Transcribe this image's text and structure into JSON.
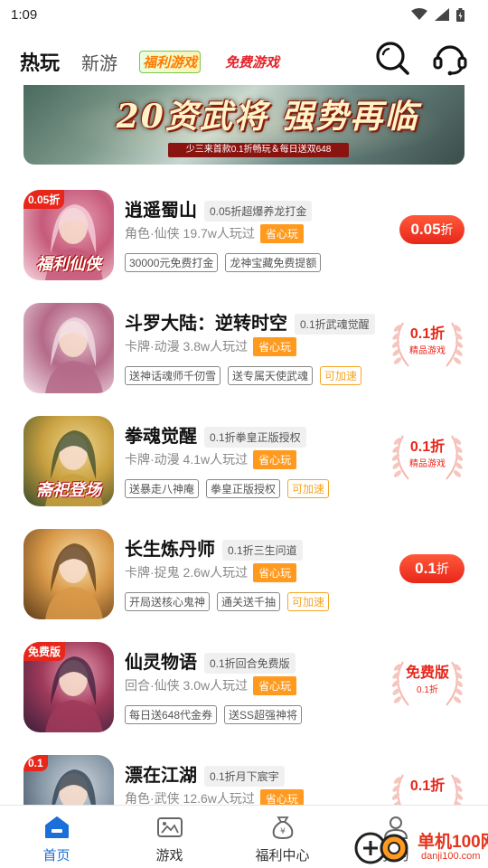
{
  "status_bar": {
    "time": "1:09",
    "icons": [
      "wifi-icon",
      "signal-icon",
      "battery-icon"
    ]
  },
  "top_nav": {
    "tabs": [
      {
        "label": "热玩",
        "active": true
      },
      {
        "label": "新游",
        "active": false
      },
      {
        "label": "福利游戏",
        "active": false
      },
      {
        "label": "免费游戏",
        "active": false
      }
    ],
    "icons": [
      "search-icon",
      "customer-service-icon"
    ]
  },
  "banner": {
    "title": "20资武将 强势再临",
    "subtitle": "少三来首款0.1折畅玩＆每日送双648"
  },
  "games": [
    {
      "name": "逍遥蜀山",
      "promo": "0.05折超爆养龙打金",
      "meta": "角色·仙侠 19.7w人玩过",
      "save": "省心玩",
      "tags": [
        {
          "text": "30000元免费打金",
          "accel": false
        },
        {
          "text": "龙神宝藏免费提额",
          "accel": false
        }
      ],
      "discount": {
        "style": "pill",
        "num": "0.05",
        "unit": "折"
      },
      "icon": {
        "name": "xiaoyao-shushan-icon",
        "label": "0.05折",
        "overlay": "福利仙侠",
        "colors": [
          "#f7d6e0",
          "#c65a7a",
          "#e8a0b4"
        ]
      }
    },
    {
      "name": "斗罗大陆：逆转时空",
      "promo": "0.1折武魂觉醒",
      "meta": "卡牌·动漫 3.8w人玩过",
      "save": "省心玩",
      "tags": [
        {
          "text": "送神话魂师千仞雪",
          "accel": false
        },
        {
          "text": "送专属天使武魂",
          "accel": false
        },
        {
          "text": "可加速",
          "accel": true
        }
      ],
      "discount": {
        "style": "seal",
        "main": "0.1折",
        "sub": "精品游戏"
      },
      "icon": {
        "name": "douluo-dalu-icon",
        "label": "",
        "overlay": "",
        "colors": [
          "#f3e0e8",
          "#b46a88",
          "#e8c4d0"
        ]
      }
    },
    {
      "name": "拳魂觉醒",
      "promo": "0.1折拳皇正版授权",
      "meta": "卡牌·动漫 4.1w人玩过",
      "save": "省心玩",
      "tags": [
        {
          "text": "送暴走八神庵",
          "accel": false
        },
        {
          "text": "拳皇正版授权",
          "accel": false
        },
        {
          "text": "可加速",
          "accel": true
        }
      ],
      "discount": {
        "style": "seal",
        "main": "0.1折",
        "sub": "精品游戏"
      },
      "icon": {
        "name": "quanhun-juexing-icon",
        "label": "",
        "overlay": "斋祀登场",
        "colors": [
          "#3a4a2a",
          "#c8a040",
          "#f0d890"
        ]
      }
    },
    {
      "name": "长生炼丹师",
      "promo": "0.1折三生问道",
      "meta": "卡牌·捉鬼 2.6w人玩过",
      "save": "省心玩",
      "tags": [
        {
          "text": "开局送核心鬼神",
          "accel": false
        },
        {
          "text": "通关送千抽",
          "accel": false
        },
        {
          "text": "可加速",
          "accel": true
        }
      ],
      "discount": {
        "style": "pill",
        "num": "0.1",
        "unit": "折"
      },
      "icon": {
        "name": "changsheng-liandanshi-icon",
        "label": "",
        "overlay": "",
        "colors": [
          "#5a3a18",
          "#d89848",
          "#f8e0a8"
        ]
      }
    },
    {
      "name": "仙灵物语",
      "promo": "0.1折回合免费版",
      "meta": "回合·仙侠 3.0w人玩过",
      "save": "省心玩",
      "tags": [
        {
          "text": "每日送648代金券",
          "accel": false
        },
        {
          "text": "送SS超强神将",
          "accel": false
        }
      ],
      "discount": {
        "style": "seal",
        "main": "免费版",
        "sub": "0.1折"
      },
      "icon": {
        "name": "xianling-wuyu-icon",
        "label": "免费版",
        "overlay": "",
        "colors": [
          "#3a1e3a",
          "#a03a5a",
          "#e8a0b8"
        ]
      }
    },
    {
      "name": "漂在江湖",
      "promo": "0.1折月下宸宇",
      "meta": "角色·武侠 12.6w人玩过",
      "save": "省心玩",
      "tags": [],
      "discount": {
        "style": "seal",
        "main": "0.1折",
        "sub": ""
      },
      "icon": {
        "name": "piaozai-jianghu-icon",
        "label": "0.1",
        "overlay": "",
        "colors": [
          "#2a3a4a",
          "#8a9aa8",
          "#d0d8e0"
        ]
      }
    }
  ],
  "tab_bar": {
    "items": [
      {
        "label": "首页",
        "active": true,
        "icon": "home-icon"
      },
      {
        "label": "游戏",
        "active": false,
        "icon": "game-icon"
      },
      {
        "label": "福利中心",
        "active": false,
        "icon": "welfare-bag-icon"
      },
      {
        "label": "我的",
        "active": false,
        "icon": "profile-icon"
      }
    ]
  },
  "watermark": {
    "title": "单机100网",
    "url": "danji100.com"
  },
  "colors": {
    "accent": "#1a6fd8",
    "discount_red": "#e8261a",
    "save_orange": "#ff9a1f",
    "accel_orange": "#f5a623"
  }
}
